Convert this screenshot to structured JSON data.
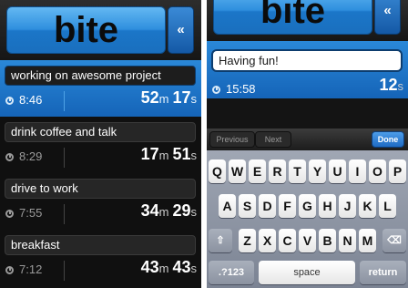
{
  "app": {
    "logo": "bite",
    "collapse_label": "«"
  },
  "left_screen": {
    "entries": [
      {
        "task": "working on awesome project",
        "start": "8:46",
        "minutes": "52",
        "seconds": "17",
        "active": true
      },
      {
        "task": "drink coffee and talk",
        "start": "8:29",
        "minutes": "17",
        "seconds": "51",
        "active": false
      },
      {
        "task": "drive to work",
        "start": "7:55",
        "minutes": "34",
        "seconds": "29",
        "active": false
      },
      {
        "task": "breakfast",
        "start": "7:12",
        "minutes": "43",
        "seconds": "43",
        "active": false
      }
    ],
    "unit_minutes": "m",
    "unit_seconds": "s"
  },
  "right_screen": {
    "note_value": "Having fun!",
    "start": "15:58",
    "seconds": "12",
    "unit_seconds": "s",
    "toolbar": {
      "previous": "Previous",
      "next": "Next",
      "done": "Done"
    },
    "keyboard": {
      "row1": [
        "Q",
        "W",
        "E",
        "R",
        "T",
        "Y",
        "U",
        "I",
        "O",
        "P"
      ],
      "row2": [
        "A",
        "S",
        "D",
        "F",
        "G",
        "H",
        "J",
        "K",
        "L"
      ],
      "row3": [
        "Z",
        "X",
        "C",
        "V",
        "B",
        "N",
        "M"
      ],
      "shift": "⇧",
      "backspace": "⌫",
      "numbers": ".?123",
      "space": "space",
      "return": "return"
    }
  },
  "colors": {
    "accent_blue": "#1f78cc",
    "background": "#101010"
  }
}
